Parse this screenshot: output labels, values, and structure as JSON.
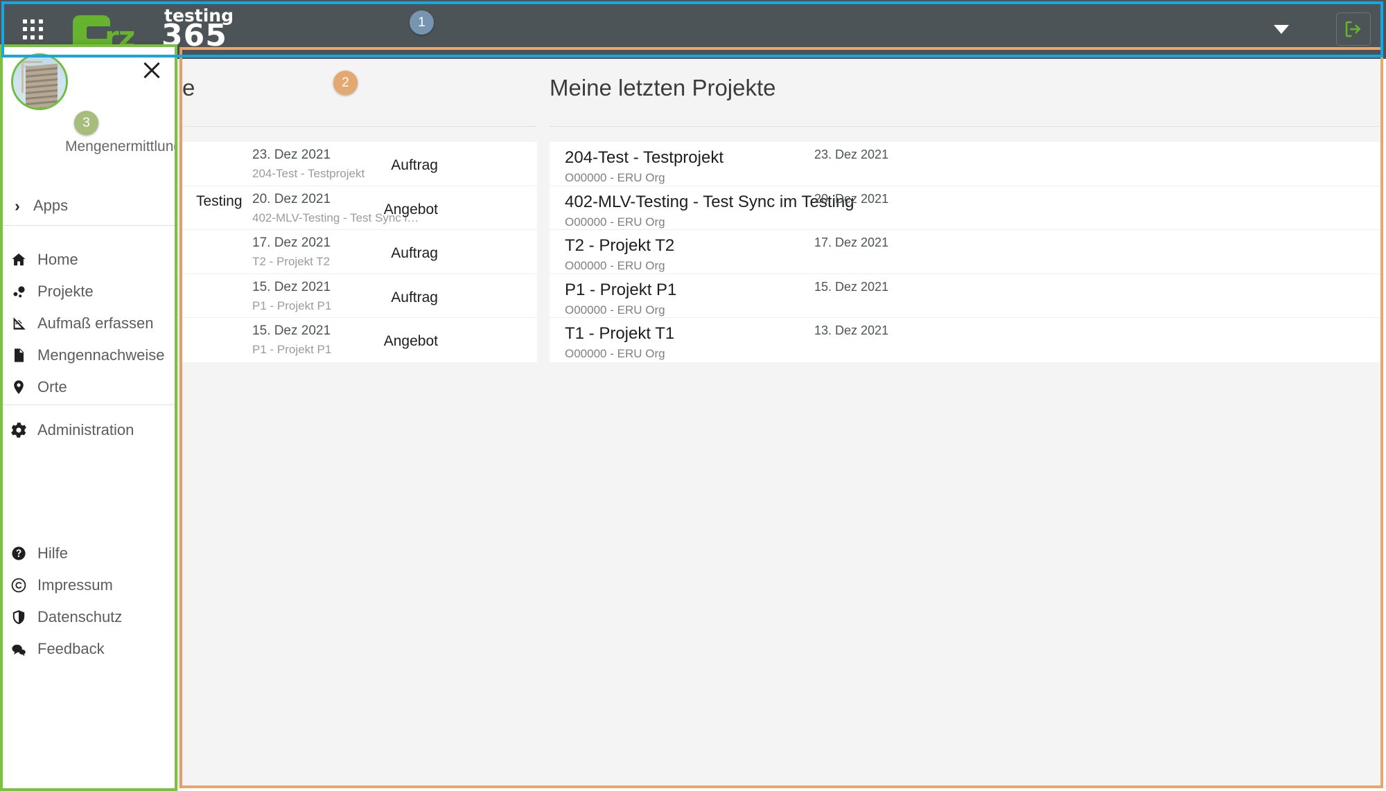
{
  "header": {
    "logo": {
      "mark_letter": "b",
      "rz": "rz",
      "testing": "testing",
      "num365": "365"
    },
    "apps_grid_icon": "grid-apps-icon",
    "caret_icon": "chevron-down-icon",
    "logout_icon": "logout-icon"
  },
  "annotations": {
    "badge1": "1",
    "badge2": "2",
    "badge3": "3"
  },
  "sidebar": {
    "user_name": "Mengenermittlung",
    "close_icon": "close-icon",
    "avatar": "avatar-building-photo",
    "apps": {
      "label": "Apps",
      "chevron": "›"
    },
    "main_items": [
      {
        "label": "Home",
        "icon": "home-icon"
      },
      {
        "label": "Projekte",
        "icon": "projects-dots-icon"
      },
      {
        "label": "Aufmaß erfassen",
        "icon": "ruler-triangle-icon"
      },
      {
        "label": "Mengennachweise",
        "icon": "document-icon"
      },
      {
        "label": "Orte",
        "icon": "map-pin-icon"
      }
    ],
    "admin_items": [
      {
        "label": "Administration",
        "icon": "gear-icon"
      }
    ],
    "footer_items": [
      {
        "label": "Hilfe",
        "icon": "question-circle-icon"
      },
      {
        "label": "Impressum",
        "icon": "copyright-icon"
      },
      {
        "label": "Datenschutz",
        "icon": "shield-icon"
      },
      {
        "label": "Feedback",
        "icon": "chat-bubbles-icon"
      }
    ]
  },
  "main": {
    "documents_panel": {
      "title_fragment": "e",
      "rows": [
        {
          "date": "23. Dez 2021",
          "project": "204-Test - Testprojekt",
          "type": "Auftrag",
          "title": ""
        },
        {
          "date": "20. Dez 2021",
          "project": "402-MLV-Testing - Test Sync i…",
          "type": "Angebot",
          "title": "Testing"
        },
        {
          "date": "17. Dez 2021",
          "project": "T2 - Projekt T2",
          "type": "Auftrag",
          "title": ""
        },
        {
          "date": "15. Dez 2021",
          "project": "P1 - Projekt P1",
          "type": "Auftrag",
          "title": ""
        },
        {
          "date": "15. Dez 2021",
          "project": "P1 - Projekt P1",
          "type": "Angebot",
          "title": ""
        }
      ]
    },
    "projects_panel": {
      "title": "Meine letzten Projekte",
      "rows": [
        {
          "name": "204-Test - Testprojekt",
          "org": "O00000 - ERU Org",
          "date": "23. Dez 2021"
        },
        {
          "name": "402-MLV-Testing - Test Sync im Testing",
          "org": "O00000 - ERU Org",
          "date": "20. Dez 2021"
        },
        {
          "name": "T2 - Projekt T2",
          "org": "O00000 - ERU Org",
          "date": "17. Dez 2021"
        },
        {
          "name": "P1 - Projekt P1",
          "org": "O00000 - ERU Org",
          "date": "15. Dez 2021"
        },
        {
          "name": "T1 - Projekt T1",
          "org": "O00000 - ERU Org",
          "date": "13. Dez 2021"
        }
      ]
    }
  },
  "colors": {
    "header_bg": "#4d5457",
    "brand_green": "#65b32e",
    "outline_blue": "#18a5e0",
    "outline_green": "#7ac143",
    "outline_orange": "#e8a76e",
    "badge_blue": "#7794b0",
    "badge_orange": "#e5a870",
    "badge_green": "#a7bd7c"
  }
}
